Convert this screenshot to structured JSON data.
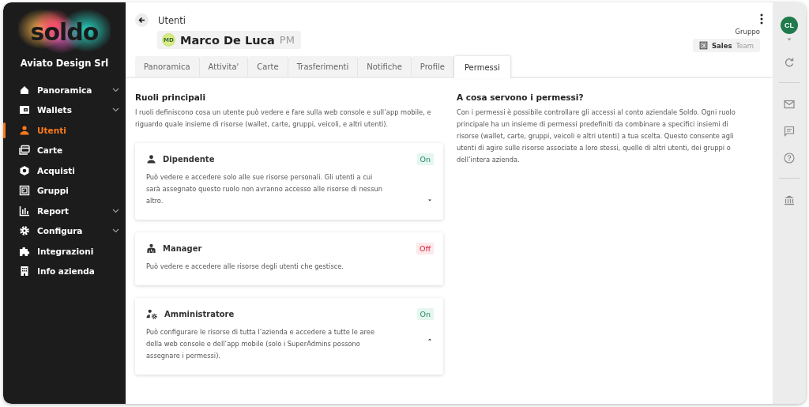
{
  "sidebar": {
    "logo": "soldo",
    "company": "Aviato Design Srl",
    "items": [
      {
        "label": "Panoramica",
        "selected": false,
        "has_submenu": true
      },
      {
        "label": "Wallets",
        "selected": false,
        "has_submenu": true
      },
      {
        "label": "Utenti",
        "selected": true,
        "has_submenu": false
      },
      {
        "label": "Carte",
        "selected": false,
        "has_submenu": false
      },
      {
        "label": "Acquisti",
        "selected": false,
        "has_submenu": false
      },
      {
        "label": "Gruppi",
        "selected": false,
        "has_submenu": false
      },
      {
        "label": "Report",
        "selected": false,
        "has_submenu": true
      },
      {
        "label": "Configura",
        "selected": false,
        "has_submenu": true
      },
      {
        "label": "Integrazioni",
        "selected": false,
        "has_submenu": false
      },
      {
        "label": "Info azienda",
        "selected": false,
        "has_submenu": false
      }
    ]
  },
  "header": {
    "breadcrumb": "Utenti",
    "user": {
      "initials": "MD",
      "name": "Marco De Luca",
      "role": "PM"
    },
    "group_label": "Gruppo",
    "group": {
      "name": "Sales",
      "type": "Team"
    }
  },
  "tabs": [
    {
      "label": "Panoramica",
      "selected": false
    },
    {
      "label": "Attivita'",
      "selected": false
    },
    {
      "label": "Carte",
      "selected": false
    },
    {
      "label": "Trasferimenti",
      "selected": false
    },
    {
      "label": "Notifiche",
      "selected": false
    },
    {
      "label": "Profile",
      "selected": false
    },
    {
      "label": "Permessi",
      "selected": true
    }
  ],
  "roles_section": {
    "title": "Ruoli principali",
    "description": "I ruoli definiscono cosa un utente può vedere e fare sulla web console e sull’app mobile, e riguardo quale insieme di risorse (wallet, carte, gruppi, veicoli, e altri utenti).",
    "roles": [
      {
        "name": "Dipendente",
        "status": "On",
        "enabled": true,
        "description": "Può vedere e accedere solo alle sue risorse personali. Gli utenti a cui sarà assegnato questo ruolo non avranno accesso alle risorse di nessun altro.",
        "expandable": true,
        "expanded": false
      },
      {
        "name": "Manager",
        "status": "Off",
        "enabled": false,
        "description": "Può vedere e accedere alle risorse degli utenti che gestisce.",
        "expandable": false
      },
      {
        "name": "Amministratore",
        "status": "On",
        "enabled": true,
        "description": "Può configurare le risorse di tutta l’azienda e accedere a tutte le aree della web console e dell’app mobile (solo i SuperAdmins possono assegnare i permessi).",
        "expandable": true,
        "expanded": true
      }
    ]
  },
  "info_section": {
    "title": "A cosa servono i permessi?",
    "text": "Con i permessi è possibile controllare gli accessi al conto aziendale Soldo. Ogni ruolo principale ha un insieme di permessi predefiniti da combinare a specifici insiemi di risorse (wallet, carte, gruppi, veicoli e altri utenti) a tua scelta. Questo consente agli utenti di agire sulle risorse associate a loro stessi, quelle di altri utenti, dei gruppi o dell’intera azienda."
  },
  "rail": {
    "avatar": "CL"
  }
}
